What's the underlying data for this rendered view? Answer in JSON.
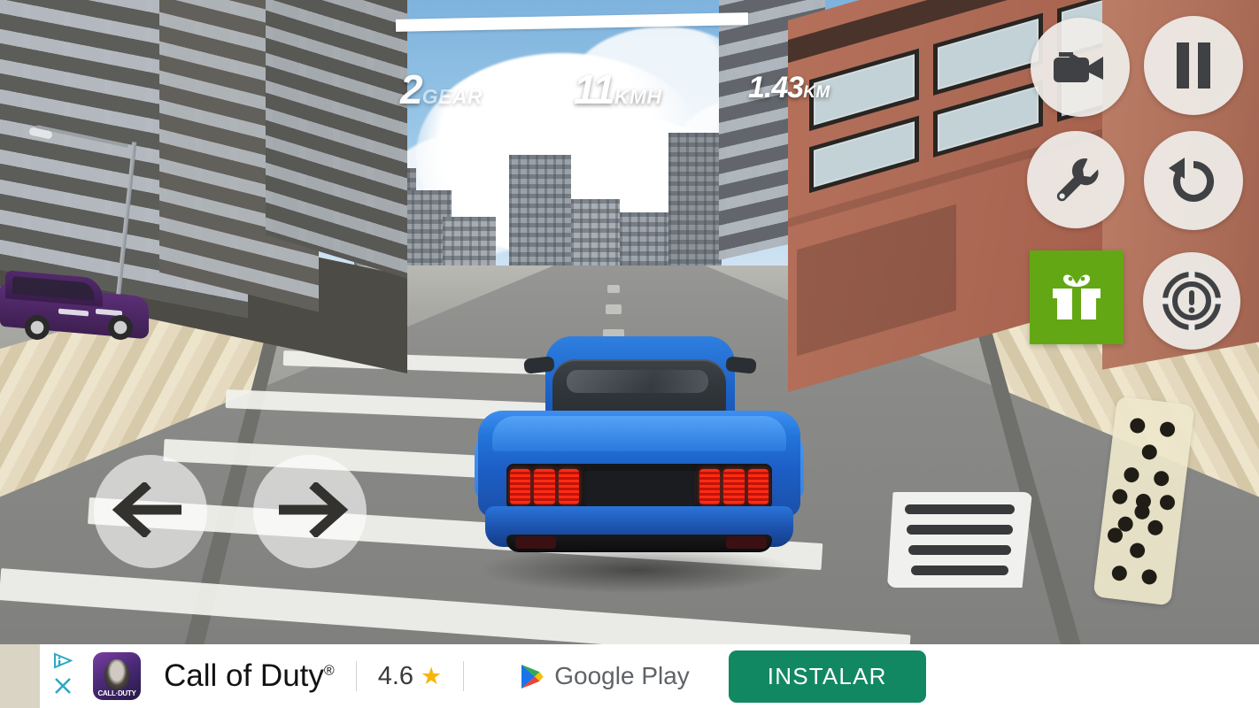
{
  "hud": {
    "gear_value": "2",
    "gear_label": "GEAR",
    "speed_value": "11",
    "speed_label": "KMH",
    "distance_value": "1.43",
    "distance_label": "KM",
    "progress_percent": 100
  },
  "controls": {
    "camera": "camera-button",
    "pause": "pause-button",
    "garage": "wrench-button",
    "reset": "reset-button",
    "gift": "gift-button",
    "handbrake": "handbrake-button",
    "steer_left": "steer-left",
    "steer_right": "steer-right",
    "brake": "brake-pedal",
    "gas": "gas-pedal",
    "gift_color": "#63a814"
  },
  "ad": {
    "title": "Call of Duty",
    "trademark": "®",
    "rating": "4.6",
    "star": "★",
    "store": "Google Play",
    "install_label": "INSTALAR",
    "install_color": "#128862",
    "adchoices_label": "AdChoices",
    "close_label": "✕",
    "icon_brand": "CALL·DUTY"
  },
  "scene": {
    "sky_color": "#9cc8e8",
    "road_color": "#8f8f8b",
    "sidewalk_color": "#e7dcc0",
    "player_car_color": "#2273d8",
    "traffic_car_color": "#5b2f76",
    "building_left_color": "#6d6a63",
    "building_right_color": "#ae6b56"
  }
}
